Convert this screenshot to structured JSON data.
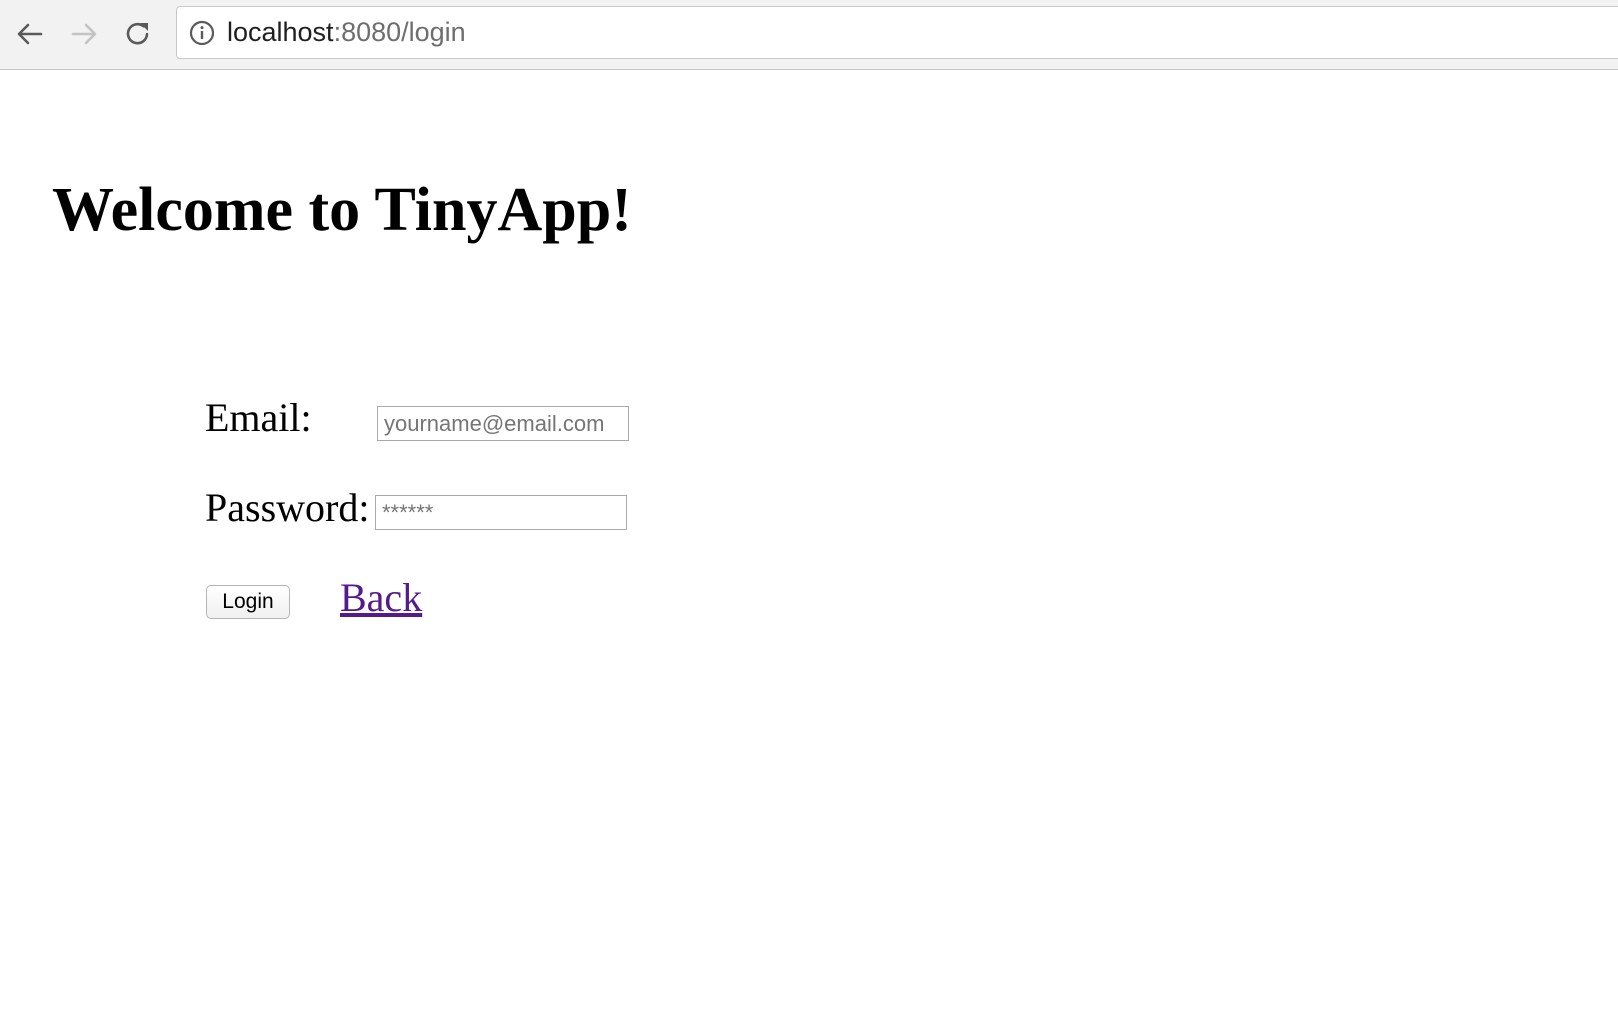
{
  "browser": {
    "url_host": "localhost",
    "url_rest": ":8080/login",
    "icons": {
      "back": "arrow-left-icon",
      "forward": "arrow-right-icon",
      "reload": "reload-icon",
      "site_info": "info-icon"
    }
  },
  "page": {
    "title": "Welcome to TinyApp!",
    "form": {
      "email_label": "Email:",
      "email_placeholder": "yourname@email.com",
      "email_value": "",
      "password_label": "Password:",
      "password_placeholder": "******",
      "password_value": "",
      "login_button": "Login",
      "back_link": "Back"
    }
  },
  "colors": {
    "visited_link": "#551a8b",
    "toolbar_bg": "#f2f2f2"
  }
}
